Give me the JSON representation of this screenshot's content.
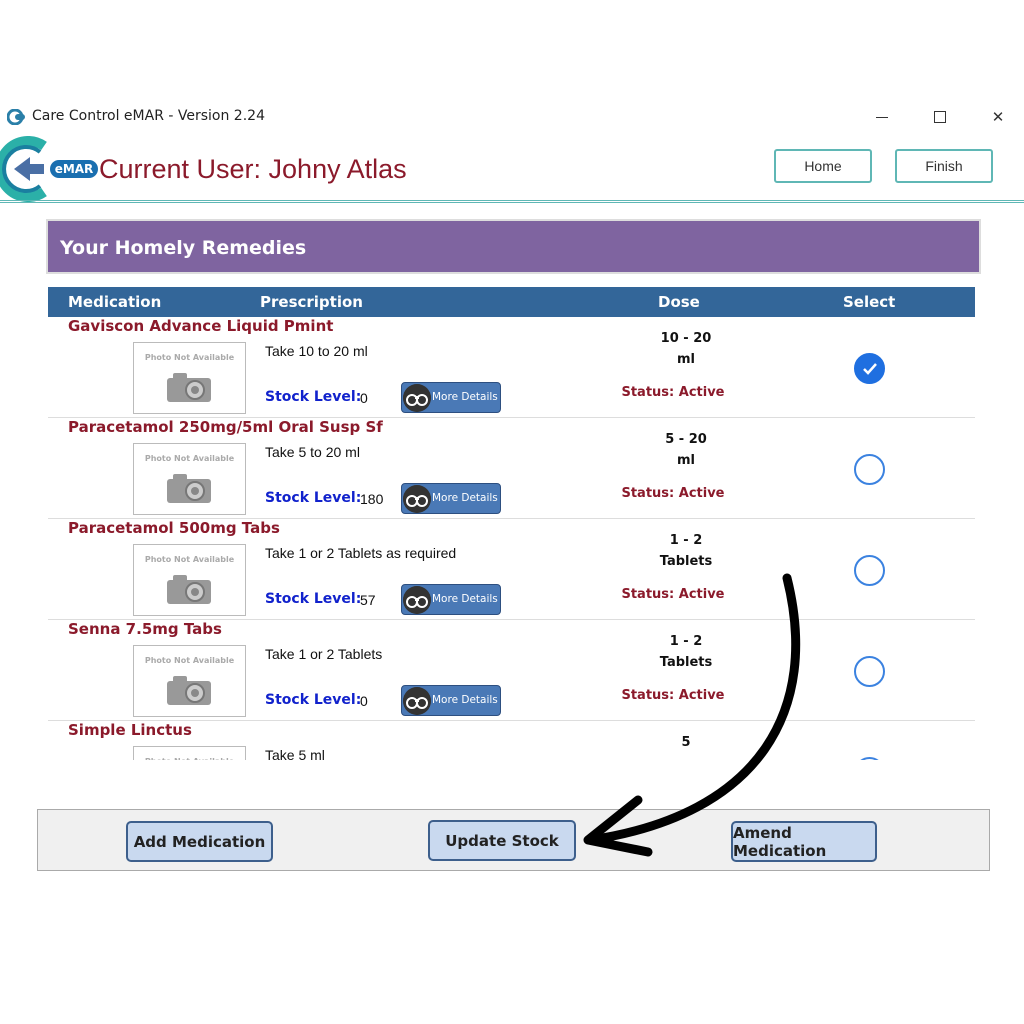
{
  "window": {
    "title": "Care Control eMAR - Version 2.24",
    "icon": "app-logo-icon",
    "controls": [
      "minimize-icon",
      "maximize-icon",
      "close-icon"
    ],
    "close_glyph": "✕"
  },
  "header": {
    "logo_text": "eMAR",
    "current_user": "Current User: Johny Atlas",
    "home_label": "Home",
    "finish_label": "Finish"
  },
  "section": {
    "title": "Your Homely Remedies"
  },
  "table": {
    "columns": {
      "medication": "Medication",
      "prescription": "Prescription",
      "dose": "Dose",
      "select": "Select"
    },
    "photo_placeholder": "Photo Not Available",
    "stock_label": "Stock Level:",
    "more_details_label": "More Details",
    "rows": [
      {
        "name": "Gaviscon Advance Liquid Pmint",
        "prescription": "Take 10 to 20 ml",
        "stock": "0",
        "dose": "10 - 20",
        "unit": "ml",
        "status": "Status: Active",
        "selected": true
      },
      {
        "name": "Paracetamol 250mg/5ml Oral Susp Sf",
        "prescription": "Take 5 to 20 ml",
        "stock": "180",
        "dose": "5 - 20",
        "unit": "ml",
        "status": "Status: Active",
        "selected": false
      },
      {
        "name": "Paracetamol 500mg Tabs",
        "prescription": "Take 1 or 2 Tablets as required",
        "stock": "57",
        "dose": "1 - 2",
        "unit": "Tablets",
        "status": "Status: Active",
        "selected": false
      },
      {
        "name": "Senna 7.5mg Tabs",
        "prescription": "Take 1 or 2 Tablets",
        "stock": "0",
        "dose": "1 - 2",
        "unit": "Tablets",
        "status": "Status: Active",
        "selected": false
      },
      {
        "name": "Simple Linctus",
        "prescription": "Take 5 ml",
        "stock": "",
        "dose": "5",
        "unit": "",
        "status": "",
        "selected": false
      }
    ]
  },
  "actions": {
    "add_label": "Add Medication",
    "update_label": "Update Stock",
    "amend_label": "Amend Medication"
  },
  "colors": {
    "accent_teal": "#5fb7b5",
    "banner_purple": "#7f64a0",
    "table_header_blue": "#336699",
    "med_name_red": "#8b1a2b",
    "stock_label_blue": "#1122cc",
    "select_blue": "#1f6fe0"
  }
}
